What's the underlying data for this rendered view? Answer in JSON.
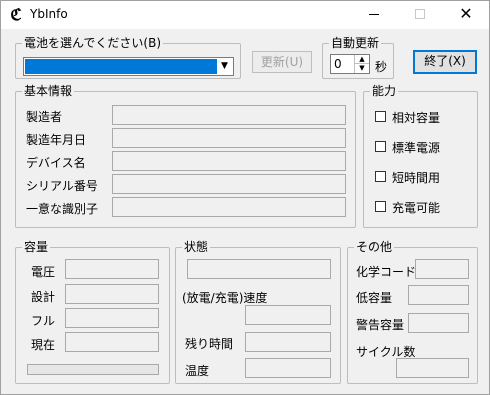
{
  "window": {
    "title": "YbInfo",
    "icon": "app-logo-icon",
    "minimize_icon": "minimize-icon",
    "maximize_icon": "maximize-icon",
    "close_glyph": "✕"
  },
  "battery_select": {
    "legend": "電池を選んでください(B)",
    "selected_value": "",
    "arrow_glyph": "▼"
  },
  "buttons": {
    "update": "更新(U)",
    "exit": "終了(X)"
  },
  "auto_update": {
    "legend": "自動更新",
    "value": "0",
    "unit": "秒",
    "up_glyph": "▲",
    "down_glyph": "▼"
  },
  "basic_info": {
    "legend": "基本情報",
    "rows": [
      {
        "label": "製造者",
        "value": ""
      },
      {
        "label": "製造年月日",
        "value": ""
      },
      {
        "label": "デバイス名",
        "value": ""
      },
      {
        "label": "シリアル番号",
        "value": ""
      },
      {
        "label": "一意な識別子",
        "value": ""
      }
    ]
  },
  "capability": {
    "legend": "能力",
    "items": [
      {
        "label": "相対容量",
        "checked": false
      },
      {
        "label": "標準電源",
        "checked": false
      },
      {
        "label": "短時間用",
        "checked": false
      },
      {
        "label": "充電可能",
        "checked": false
      }
    ]
  },
  "capacity": {
    "legend": "容量",
    "rows": [
      {
        "label": "電圧",
        "value": ""
      },
      {
        "label": "設計",
        "value": ""
      },
      {
        "label": "フル",
        "value": ""
      },
      {
        "label": "現在",
        "value": ""
      }
    ],
    "bar_value": ""
  },
  "state": {
    "legend": "状態",
    "status_value": "",
    "rate_label": "(放電/充電)速度",
    "rate_value": "",
    "remaining_label": "残り時間",
    "remaining_value": "",
    "temperature_label": "温度",
    "temperature_value": ""
  },
  "other": {
    "legend": "その他",
    "chemistry_label": "化学コード",
    "chemistry_value": "",
    "low_label": "低容量",
    "low_value": "",
    "warning_label": "警告容量",
    "warning_value": "",
    "cycle_label": "サイクル数",
    "cycle_value": ""
  }
}
